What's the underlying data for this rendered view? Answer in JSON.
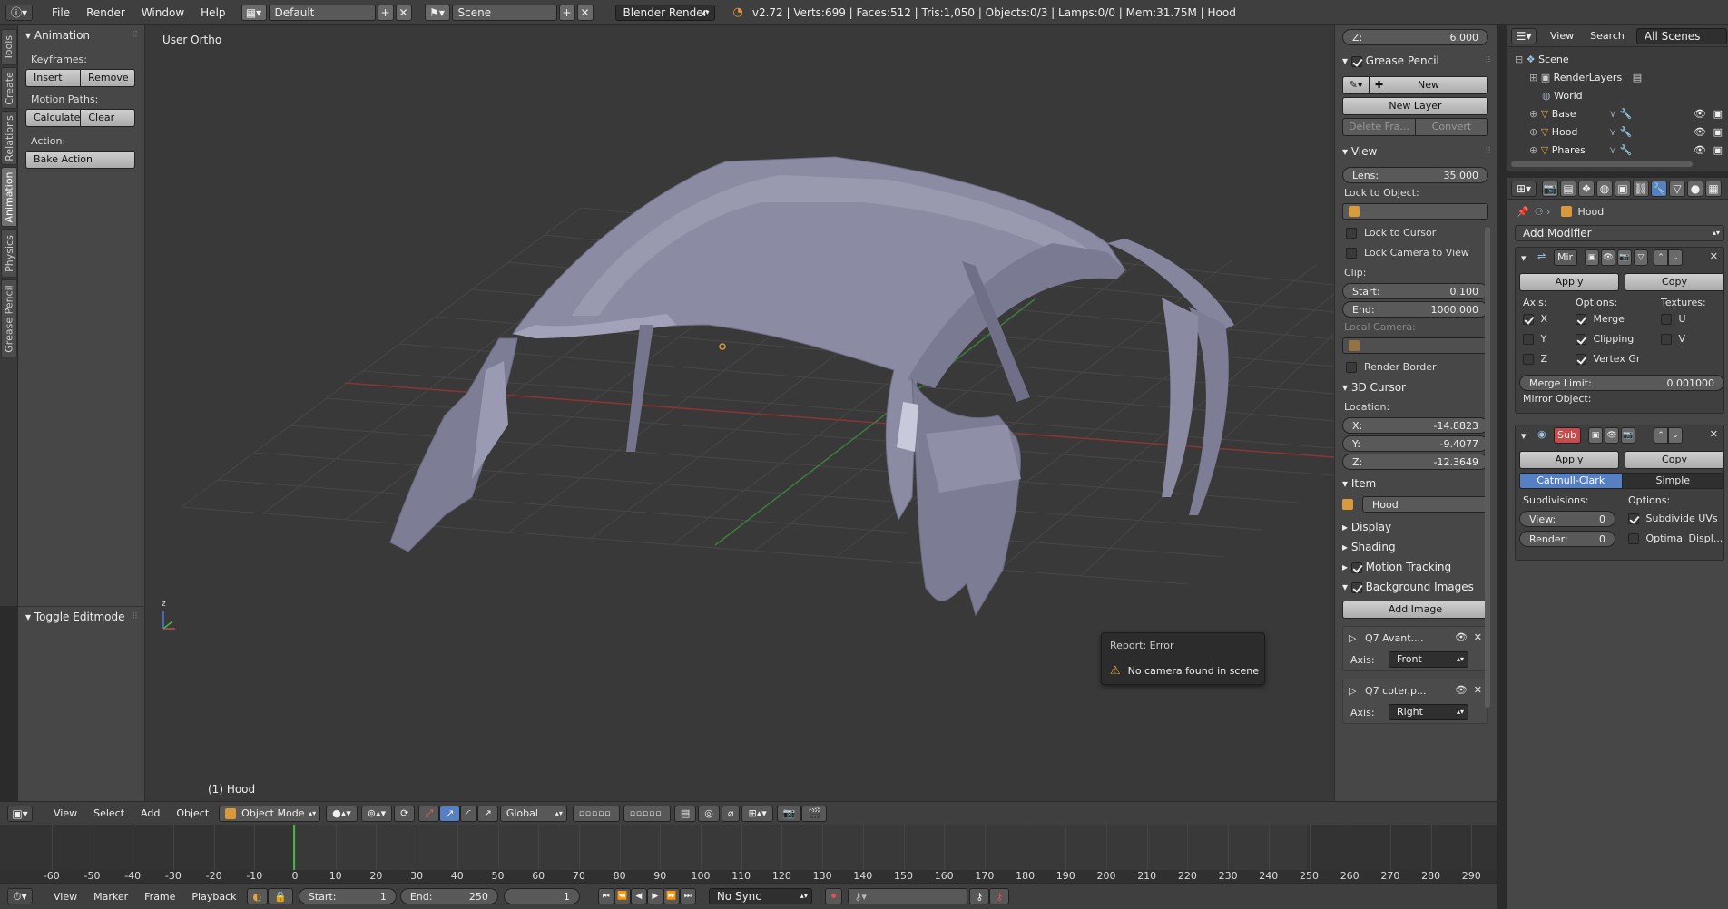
{
  "topbar": {
    "menus": [
      "File",
      "Render",
      "Window",
      "Help"
    ],
    "screen_layout": "Default",
    "scene": "Scene",
    "render_engine": "Blender Render",
    "stats": "v2.72 | Verts:699 | Faces:512 | Tris:1,050 | Objects:0/3 | Lamps:0/0 | Mem:31.75M | Hood"
  },
  "tool_tabs": [
    "Tools",
    "Create",
    "Relations",
    "Animation",
    "Physics",
    "Grease Pencil"
  ],
  "toolshelf": {
    "animation_title": "Animation",
    "keyframes_label": "Keyframes:",
    "insert": "Insert",
    "remove": "Remove",
    "motion_paths_label": "Motion Paths:",
    "calculate": "Calculate",
    "clear": "Clear",
    "action_label": "Action:",
    "bake_action": "Bake Action",
    "toggle_editmode": "Toggle Editmode"
  },
  "viewport": {
    "view_name": "User Ortho",
    "object_label": "(1) Hood",
    "report_title": "Report: Error",
    "report_message": "No camera found in scene"
  },
  "npanel": {
    "z_label": "Z:",
    "z_value": "6.000",
    "grease_pencil": "Grease Pencil",
    "new": "New",
    "new_layer": "New Layer",
    "delete_frame": "Delete Fra...",
    "convert": "Convert",
    "view_title": "View",
    "lens_label": "Lens:",
    "lens_value": "35.000",
    "lock_to_object": "Lock to Object:",
    "lock_to_cursor": "Lock to Cursor",
    "lock_camera": "Lock Camera to View",
    "clip_label": "Clip:",
    "clip_start_label": "Start:",
    "clip_start": "0.100",
    "clip_end_label": "End:",
    "clip_end": "1000.000",
    "local_camera": "Local Camera:",
    "render_border": "Render Border",
    "cursor_title": "3D Cursor",
    "location_label": "Location:",
    "cx_label": "X:",
    "cx": "-14.8823",
    "cy_label": "Y:",
    "cy": "-9.4077",
    "cz_label": "Z:",
    "cz": "-12.3649",
    "item_title": "Item",
    "item_name": "Hood",
    "display": "Display",
    "shading": "Shading",
    "motion_tracking": "Motion Tracking",
    "background_images": "Background Images",
    "add_image": "Add Image",
    "bg1_name": "Q7 Avant....",
    "bg1_axis_label": "Axis:",
    "bg1_axis": "Front",
    "bg2_name": "Q7 coter.p...",
    "bg2_axis_label": "Axis:",
    "bg2_axis": "Right"
  },
  "outliner": {
    "menus": [
      "View",
      "Search"
    ],
    "filter": "All Scenes",
    "items": [
      "Scene",
      "RenderLayers",
      "World",
      "Base",
      "Hood",
      "Phares"
    ]
  },
  "properties": {
    "object_name": "Hood",
    "add_modifier": "Add Modifier",
    "mirror": {
      "name": "Mir",
      "apply": "Apply",
      "copy": "Copy",
      "axis_label": "Axis:",
      "options_label": "Options:",
      "textures_label": "Textures:",
      "x": "X",
      "y": "Y",
      "z": "Z",
      "merge": "Merge",
      "clipping": "Clipping",
      "vertex_gr": "Vertex Gr",
      "u": "U",
      "v": "V",
      "merge_limit_label": "Merge Limit:",
      "merge_limit": "0.001000",
      "mirror_object": "Mirror Object:"
    },
    "subsurf": {
      "name": "Sub",
      "apply": "Apply",
      "copy": "Copy",
      "catmull": "Catmull-Clark",
      "simple": "Simple",
      "subdivisions_label": "Subdivisions:",
      "options_label": "Options:",
      "view_label": "View:",
      "view": "0",
      "render_label": "Render:",
      "render": "0",
      "subdivide_uvs": "Subdivide UVs",
      "optimal_display": "Optimal Displ..."
    }
  },
  "view_header": {
    "menus": [
      "View",
      "Select",
      "Add",
      "Object"
    ],
    "mode": "Object Mode",
    "orientation": "Global"
  },
  "timeline": {
    "ticks": [
      "-60",
      "-50",
      "-40",
      "-30",
      "-20",
      "-10",
      "0",
      "10",
      "20",
      "30",
      "40",
      "50",
      "60",
      "70",
      "80",
      "90",
      "100",
      "110",
      "120",
      "130",
      "140",
      "150",
      "160",
      "170",
      "180",
      "190",
      "200",
      "210",
      "220",
      "230",
      "240",
      "250",
      "260",
      "270",
      "280",
      "290"
    ],
    "menus": [
      "View",
      "Marker",
      "Frame",
      "Playback"
    ],
    "start_label": "Start:",
    "start": "1",
    "end_label": "End:",
    "end": "250",
    "current": "1",
    "sync": "No Sync"
  },
  "colors": {
    "accent_blue": "#5680c2",
    "sub_red": "#c54c4c",
    "cursor_orange": "#d99a3c",
    "frame_green": "#3fb83f"
  }
}
